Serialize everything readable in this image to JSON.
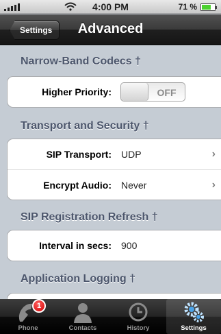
{
  "status_bar": {
    "time": "4:00 PM",
    "battery_percent_label": "71 %",
    "battery_level": 0.71,
    "signal_icon": "signal-bars-icon",
    "wifi_icon": "wifi-icon"
  },
  "nav": {
    "back_label": "Settings",
    "title": "Advanced"
  },
  "sections": {
    "narrowband": {
      "title": "Narrow-Band Codecs †",
      "higher_priority_label": "Higher Priority:",
      "higher_priority_value": "OFF"
    },
    "transport": {
      "title": "Transport and Security †",
      "sip_transport_label": "SIP Transport:",
      "sip_transport_value": "UDP",
      "encrypt_audio_label": "Encrypt Audio:",
      "encrypt_audio_value": "Never",
      "chevron": "›"
    },
    "registration": {
      "title": "SIP Registration Refresh †",
      "interval_label": "Interval in secs:",
      "interval_value": "900"
    },
    "logging": {
      "title": "Application Logging †"
    }
  },
  "tabbar": {
    "phone_label": "Phone",
    "phone_badge": "1",
    "contacts_label": "Contacts",
    "history_label": "History",
    "settings_label": "Settings",
    "active_tab": "Settings"
  },
  "colors": {
    "section_title": "#4c566c",
    "background": "#c5ccd4",
    "battery_fill": "#4cd130",
    "badge": "#d10000"
  }
}
